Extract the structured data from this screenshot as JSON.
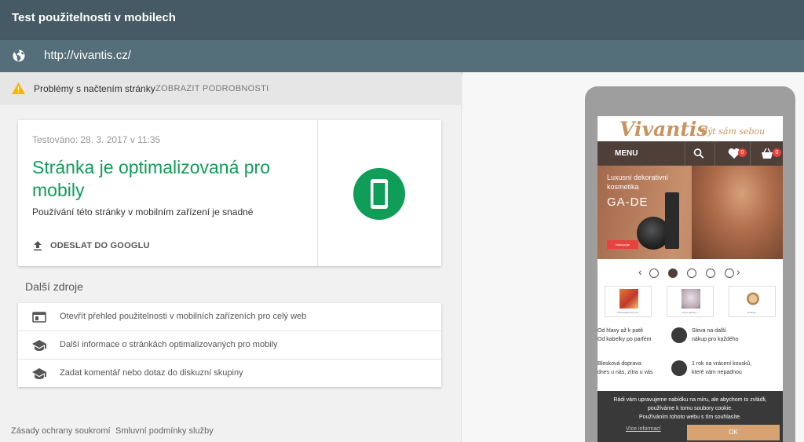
{
  "app": {
    "title": "Test použitelnosti v mobilech"
  },
  "urlbar": {
    "url": "http://vivantis.cz/",
    "icon": "globe-icon"
  },
  "warning": {
    "icon": "warning-icon",
    "text": "Problémy s načtením stránky",
    "details_label": "ZOBRAZIT PODROBNOSTI",
    "color": "#f4b400"
  },
  "result": {
    "tested": "Testováno: 28. 3. 2017 v 11:35",
    "verdict": "Stránka je optimalizovaná pro mobily",
    "subtitle": "Používání této stránky v mobilním zařízení je snadné",
    "submit_label": "ODESLAT DO GOOGLU",
    "accent": "#0f9d58"
  },
  "resources": {
    "title": "Další zdroje",
    "items": [
      {
        "icon": "browser-window-icon",
        "label": "Otevřít přehled použitelnosti v mobilních zařízeních pro celý web"
      },
      {
        "icon": "school-icon",
        "label": "Další informace o stránkách optimalizovaných pro mobily"
      },
      {
        "icon": "school-icon",
        "label": "Zadat komentář nebo dotaz do diskuzní skupiny"
      }
    ]
  },
  "footer": {
    "privacy": "Zásady ochrany soukromí",
    "terms": "Smluvní podmínky služby"
  },
  "preview": {
    "logo": "Vivantis",
    "tagline": "Být sám sebou",
    "menu_label": "MENU",
    "wishlist_count": "0",
    "cart_count": "0",
    "banner": {
      "line1": "Luxusní dekorativní",
      "line2": "kosmetika",
      "brand": "GA-DE",
      "button": "Nakupujte"
    },
    "carousel": {
      "dot_count": 5,
      "active_index": 1
    },
    "products": [
      {
        "caption": "Kosmetické sety za ..."
      },
      {
        "caption": "Nové parfémy ..."
      },
      {
        "caption": "Hodinky ..."
      }
    ],
    "features": [
      {
        "lines": [
          "Od hlavy až k patě",
          "Od kabelky po parfém"
        ]
      },
      {
        "lines": [
          "Sleva na další",
          "nákup pro každého"
        ]
      },
      {
        "lines": [
          "Blesková doprava",
          "dnes u nás, zítra u vás"
        ]
      },
      {
        "lines": [
          "1 rok na vrácení kousků,",
          "které vám nepadnou"
        ]
      }
    ],
    "cookie": {
      "line1": "Rádi vám upravujeme nabídku na míru, ale abychom to zvládli,",
      "line2": "používáme k tomu soubory cookie.",
      "line3": "Používáním tohoto webu s tím souhlasíte.",
      "link": "Více informací",
      "ok": "OK"
    }
  }
}
